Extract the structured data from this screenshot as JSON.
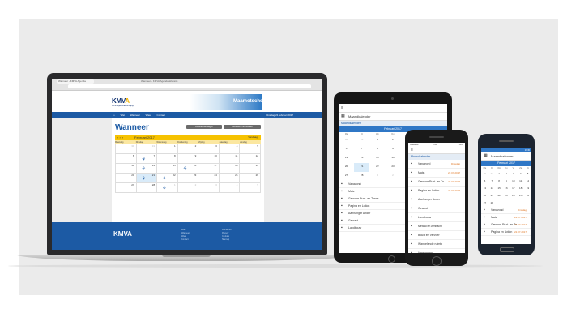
{
  "laptop": {
    "browser": {
      "tab_label": "Wanneer - KMVA Agenda",
      "window_title": "Wanneer - KMVA Agenda Website"
    },
    "site": {
      "logo_main": "KMV",
      "logo_accent": "A",
      "logo_sub": "Koninklijke Maatschappij",
      "banner_title": "Maamotschema",
      "nav": [
        "Wat",
        "Wanneer",
        "Waar",
        "Contact"
      ],
      "nav_right": "Dinsdag 21 februari 2017",
      "page_title": "Wanneer",
      "buttons": [
        "Activiteit toevoegen",
        "Afdrukken / Exporteren"
      ],
      "calendar": {
        "month_label": "Februari 2017",
        "today_label": "Vandaag",
        "dow": [
          "Maandag",
          "Dinsdag",
          "Woensdag",
          "Donderdag",
          "Vrijdag",
          "Zaterdag",
          "Zondag"
        ],
        "days": [
          "30",
          "31",
          "1",
          "2",
          "3",
          "4",
          "5",
          "6",
          "7",
          "8",
          "9",
          "10",
          "11",
          "12",
          "13",
          "14",
          "15",
          "16",
          "17",
          "18",
          "19",
          "20",
          "21",
          "22",
          "23",
          "24",
          "25",
          "26",
          "27",
          "28",
          "1",
          "2",
          "3",
          "4",
          "5"
        ]
      },
      "footer_logo": "KMVA",
      "footer_cols": [
        [
          "Wat",
          "Wanneer",
          "Waar",
          "Contact"
        ],
        [
          "Disclaimer",
          "Privacy",
          "Cookies",
          "Sitemap"
        ]
      ]
    }
  },
  "tablet": {
    "app_title": "Maandkalender",
    "sub_label": "Maandkalender",
    "month_label": "Februari 2017",
    "dow": [
      "Ma",
      "Di",
      "Wo",
      "Do",
      "Vr",
      "Za",
      "Zo"
    ],
    "days": [
      "30",
      "31",
      "1",
      "2",
      "3",
      "4",
      "5",
      "6",
      "7",
      "8",
      "9",
      "10",
      "11",
      "12",
      "13",
      "14",
      "15",
      "16",
      "17",
      "18",
      "19",
      "20",
      "21",
      "22",
      "23",
      "24",
      "25",
      "26",
      "27",
      "28",
      "1",
      "2",
      "3",
      "4",
      "5"
    ],
    "list": [
      "Vanavond",
      "Mais",
      "Gewone Rust- en Tarwe",
      "Pagina en Lotion",
      "Aanhanger Ander",
      "Gewast",
      "Landbouw"
    ]
  },
  "iphone": {
    "status_left": "Vodafone",
    "status_time": "9:41",
    "status_right": "100%",
    "sub_label": "Maandkalender",
    "list": [
      {
        "label": "Vanavond",
        "value": "Dinsdag"
      },
      {
        "label": "Mais",
        "value": "22.07.2017"
      },
      {
        "label": "Gewone Rust- en Ta...",
        "value": "22.07.2017"
      },
      {
        "label": "Pagina en Lotion",
        "value": "22.07.2017"
      },
      {
        "label": "Aanhanger Ander",
        "value": ""
      },
      {
        "label": "Gewast",
        "value": ""
      },
      {
        "label": "Landbouw",
        "value": ""
      },
      {
        "label": "Metaal en Ambacht",
        "value": ""
      },
      {
        "label": "Bouw en Vervoer",
        "value": ""
      },
      {
        "label": "Wandelende ruimte",
        "value": ""
      },
      {
        "label": "Vergunning",
        "value": ""
      }
    ]
  },
  "samsung": {
    "status_time": "13:30",
    "app_title": "Maandkalender",
    "month_label": "Februari 2017",
    "dow": [
      "Ma",
      "Di",
      "Wo",
      "Do",
      "Vr",
      "Za",
      "Zo"
    ],
    "days": [
      "30",
      "31",
      "1",
      "2",
      "3",
      "4",
      "5",
      "6",
      "7",
      "8",
      "9",
      "10",
      "11",
      "12",
      "13",
      "14",
      "15",
      "16",
      "17",
      "18",
      "19",
      "20",
      "21",
      "22",
      "23",
      "24",
      "25",
      "26",
      "27",
      "28"
    ],
    "list": [
      {
        "label": "Vanavond",
        "value": "Dinsdag"
      },
      {
        "label": "Mais",
        "value": "22.07.2017"
      },
      {
        "label": "Gewone Rust- en Ta...",
        "value": "22.07.2017"
      },
      {
        "label": "Pagina en Lotion",
        "value": "22.07.2017"
      }
    ]
  },
  "colors": {
    "brand_blue": "#1c5aa4",
    "accent_yellow": "#f6c200",
    "event_orange": "#e07a2a"
  }
}
